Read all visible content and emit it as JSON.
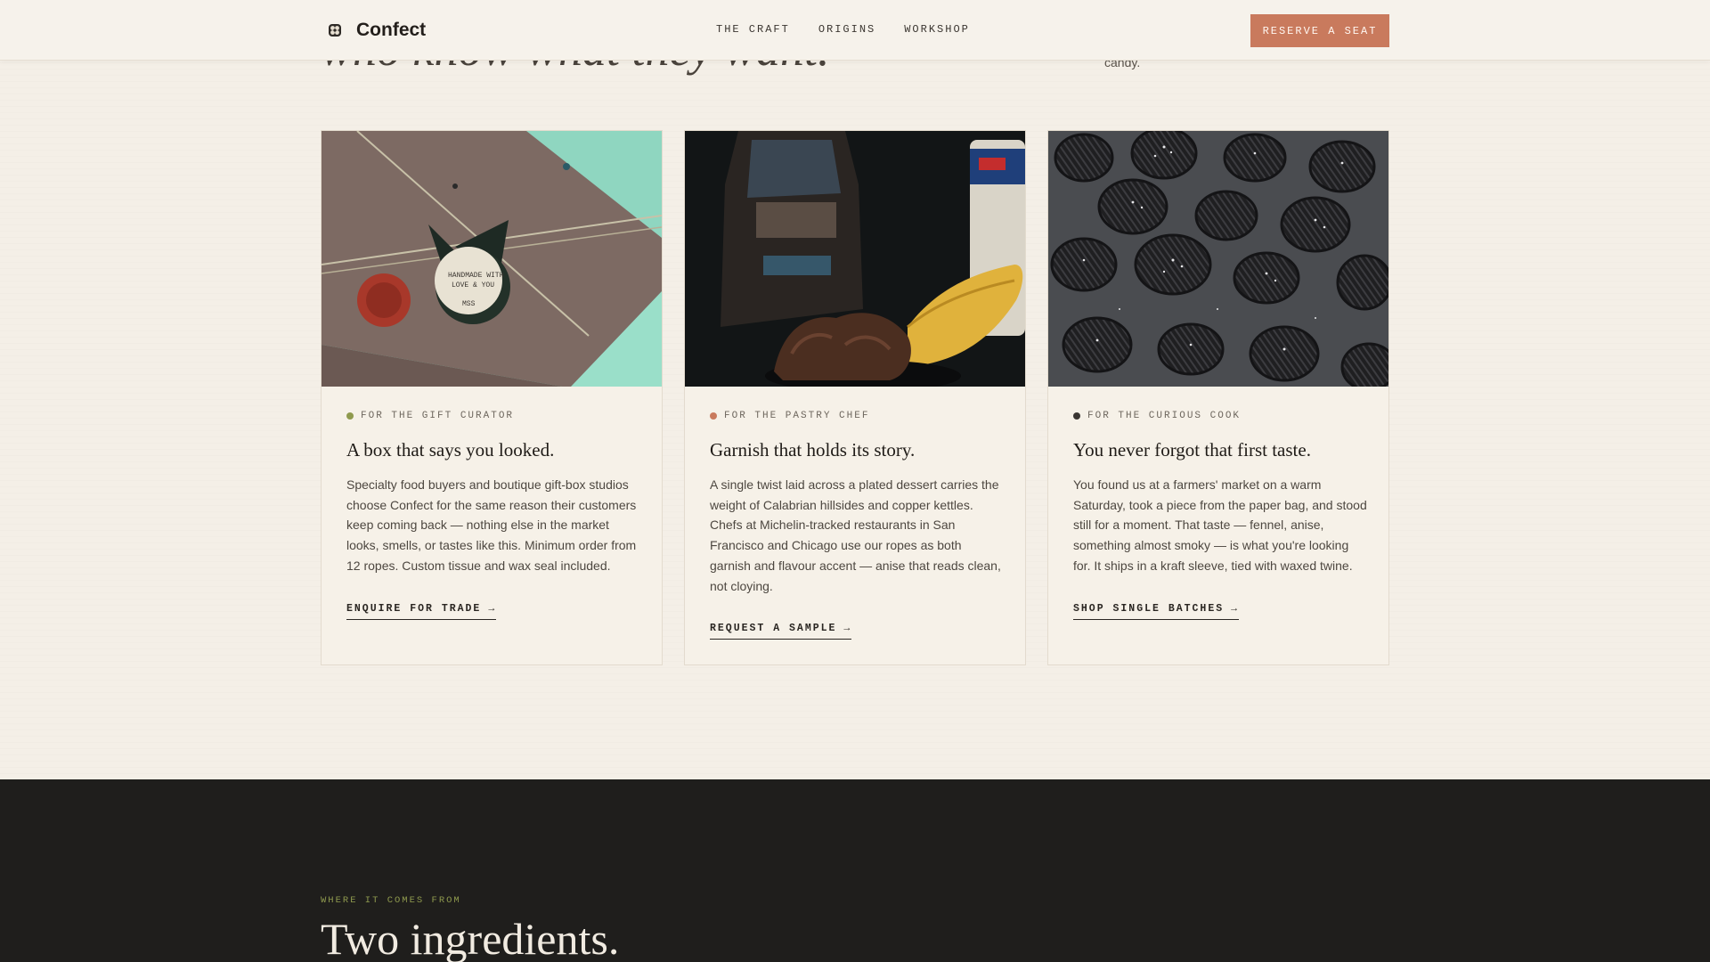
{
  "header": {
    "brand": "Confect",
    "nav": [
      "THE CRAFT",
      "ORIGINS",
      "WORKSHOP"
    ],
    "cta": "RESERVE A SEAT"
  },
  "hero": {
    "fragment": "who know what they want.",
    "side_fragment": "candy."
  },
  "cards": [
    {
      "eyebrow": "FOR THE GIFT CURATOR",
      "dot_color": "#8f9a4e",
      "title": "A box that says you looked.",
      "text": "Specialty food buyers and boutique gift-box studios choose Confect for the same reason their customers keep coming back — nothing else in the market looks, smells, or tastes like this. Minimum order from 12 ropes. Custom tissue and wax seal included.",
      "link": "ENQUIRE FOR TRADE",
      "tag_text": [
        "HANDMADE WITH",
        "LOVE & YOU",
        "MSS"
      ]
    },
    {
      "eyebrow": "FOR THE PASTRY CHEF",
      "dot_color": "#c97a5d",
      "title": "Garnish that holds its story.",
      "text": "A single twist laid across a plated dessert carries the weight of Calabrian hillsides and copper kettles. Chefs at Michelin-tracked restaurants in San Francisco and Chicago use our ropes as both garnish and flavour accent — anise that reads clean, not cloying.",
      "link": "REQUEST A SAMPLE"
    },
    {
      "eyebrow": "FOR THE CURIOUS COOK",
      "dot_color": "#3a3632",
      "title": "You never forgot that first taste.",
      "text": "You found us at a farmers' market on a warm Saturday, took a piece from the paper bag, and stood still for a moment. That taste — fennel, anise, something almost smoky — is what you're looking for. It ships in a kraft sleeve, tied with waxed twine.",
      "link": "SHOP SINGLE BATCHES"
    }
  ],
  "origins": {
    "eyebrow": "WHERE IT COMES FROM",
    "title": "Two ingredients."
  }
}
